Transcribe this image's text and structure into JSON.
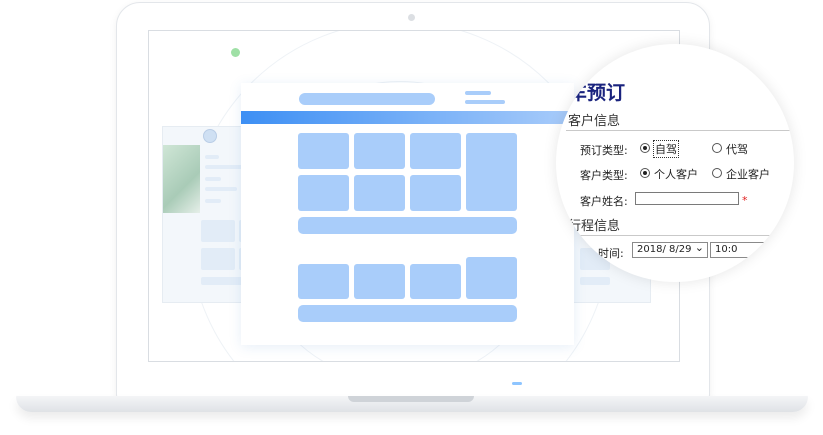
{
  "zoom_panel": {
    "title": "车预订",
    "section_customer": "客户信息",
    "booking_type_label": "预订类型:",
    "booking_option_self": "自驾",
    "booking_option_driver": "代驾",
    "customer_type_label": "客户类型:",
    "customer_option_personal": "个人客户",
    "customer_option_company": "企业客户",
    "customer_name_label": "客户姓名:",
    "customer_name_value": "",
    "required_mark": "*",
    "section_trip": "行程信息",
    "time_label": "时间:",
    "date_value": "2018/ 8/29",
    "time_value": "10:0",
    "chevron": "⌄"
  },
  "colors": {
    "accent_blue": "#3d8ff4",
    "placeholder_blue": "#a9cdfa",
    "title_navy": "#1a237e",
    "required_red": "#e02020"
  }
}
